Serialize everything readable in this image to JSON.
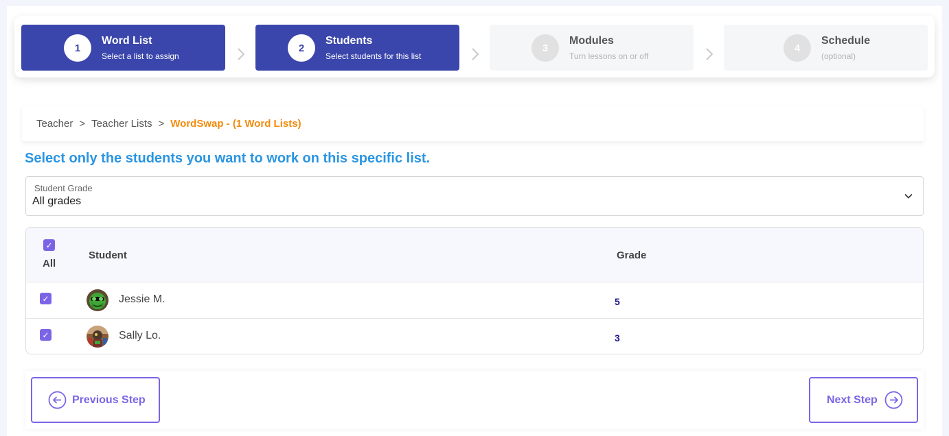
{
  "stepper": {
    "steps": [
      {
        "number": "1",
        "title": "Word List",
        "subtitle": "Select a list to assign",
        "state": "complete"
      },
      {
        "number": "2",
        "title": "Students",
        "subtitle": "Select students for this list",
        "state": "active"
      },
      {
        "number": "3",
        "title": "Modules",
        "subtitle": "Turn lessons on or off",
        "state": "inactive"
      },
      {
        "number": "4",
        "title": "Schedule",
        "subtitle": "(optional)",
        "state": "inactive"
      }
    ]
  },
  "breadcrumb": {
    "items": [
      "Teacher",
      "Teacher Lists"
    ],
    "separator": ">",
    "current": "WordSwap - (1 Word Lists)"
  },
  "instruction": "Select only the students you want to work on this specific list.",
  "grade_filter": {
    "label": "Student Grade",
    "value": "All grades"
  },
  "table": {
    "select_all_label": "All",
    "select_all_checked": true,
    "columns": [
      "Student",
      "Grade"
    ],
    "rows": [
      {
        "name": "Jessie M.",
        "grade": "5",
        "checked": true,
        "avatar": "cactus-avatar"
      },
      {
        "name": "Sally Lo.",
        "grade": "3",
        "checked": true,
        "avatar": "robot-avatar"
      }
    ]
  },
  "nav": {
    "previous_label": "Previous Step",
    "next_label": "Next Step"
  },
  "colors": {
    "active_step": "#3a46ab",
    "accent_purple": "#7c64e6",
    "breadcrumb_current": "#f28b0c",
    "instruction_blue": "#2a95e2",
    "grade_text": "#231a8a"
  }
}
